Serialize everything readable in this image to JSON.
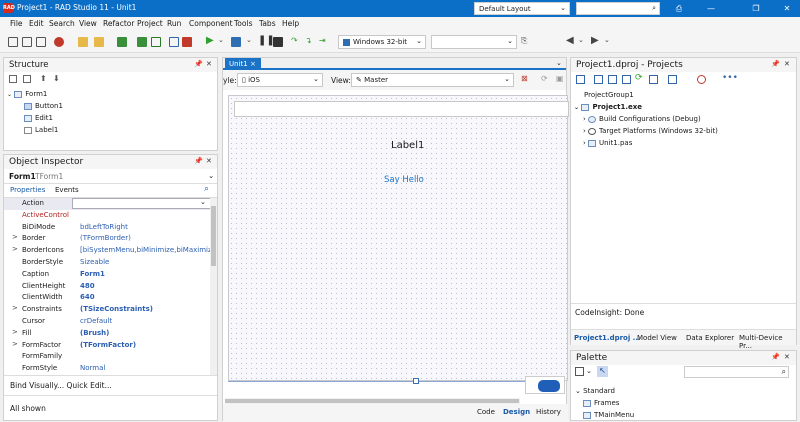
{
  "titlebar": {
    "title": "Project1 - RAD Studio 11 - Unit1",
    "layout": "Default Layout",
    "logo": "RAD"
  },
  "menu": [
    "File",
    "Edit",
    "Search",
    "View",
    "Refactor",
    "Project",
    "Run",
    "Component",
    "Tools",
    "Tabs",
    "Help"
  ],
  "toolbar": {
    "platform": "Windows 32-bit"
  },
  "structure": {
    "title": "Structure",
    "items": [
      "Form1",
      "Button1",
      "Edit1",
      "Label1"
    ]
  },
  "object_inspector": {
    "title": "Object Inspector",
    "form_name": "Form1",
    "form_type": "TForm1",
    "tabs": [
      "Properties",
      "Events"
    ],
    "rows": [
      {
        "k": "Action",
        "v": "",
        "exp": ""
      },
      {
        "k": "ActiveControl",
        "v": "",
        "exp": ""
      },
      {
        "k": "BiDiMode",
        "v": "bdLeftToRight",
        "exp": ""
      },
      {
        "k": "Border",
        "v": "(TFormBorder)",
        "exp": ">"
      },
      {
        "k": "BorderIcons",
        "v": "[biSystemMenu,biMinimize,biMaximize]",
        "exp": ">"
      },
      {
        "k": "BorderStyle",
        "v": "Sizeable",
        "exp": ""
      },
      {
        "k": "Caption",
        "v": "Form1",
        "exp": ""
      },
      {
        "k": "ClientHeight",
        "v": "480",
        "exp": ""
      },
      {
        "k": "ClientWidth",
        "v": "640",
        "exp": ""
      },
      {
        "k": "Constraints",
        "v": "(TSizeConstraints)",
        "exp": ">"
      },
      {
        "k": "Cursor",
        "v": "crDefault",
        "exp": ""
      },
      {
        "k": "Fill",
        "v": "(Brush)",
        "exp": ">"
      },
      {
        "k": "FormFactor",
        "v": "(TFormFactor)",
        "exp": ">"
      },
      {
        "k": "FormFamily",
        "v": "",
        "exp": ""
      },
      {
        "k": "FormStyle",
        "v": "Normal",
        "exp": ""
      }
    ],
    "links": "Bind Visually...  Quick Edit...",
    "status": "All shown"
  },
  "designer": {
    "tab": "Unit1",
    "style_label": "yle:",
    "style_value": "iOS",
    "view_label": "View:",
    "view_value": "Master",
    "label1": "Label1",
    "button": "Say Hello",
    "bottom_tabs": [
      "Code",
      "Design",
      "History"
    ]
  },
  "projects": {
    "title": "Project1.dproj - Projects",
    "group": "ProjectGroup1",
    "exe": "Project1.exe",
    "items": [
      "Build Configurations (Debug)",
      "Target Platforms (Windows 32-bit)",
      "Unit1.pas"
    ],
    "status": "CodeInsight: Done",
    "tabs": [
      "Project1.dproj ...",
      "Model View",
      "Data Explorer",
      "Multi-Device Pr..."
    ]
  },
  "palette": {
    "title": "Palette",
    "items": [
      "Standard",
      "Frames",
      "TMainMenu"
    ]
  }
}
